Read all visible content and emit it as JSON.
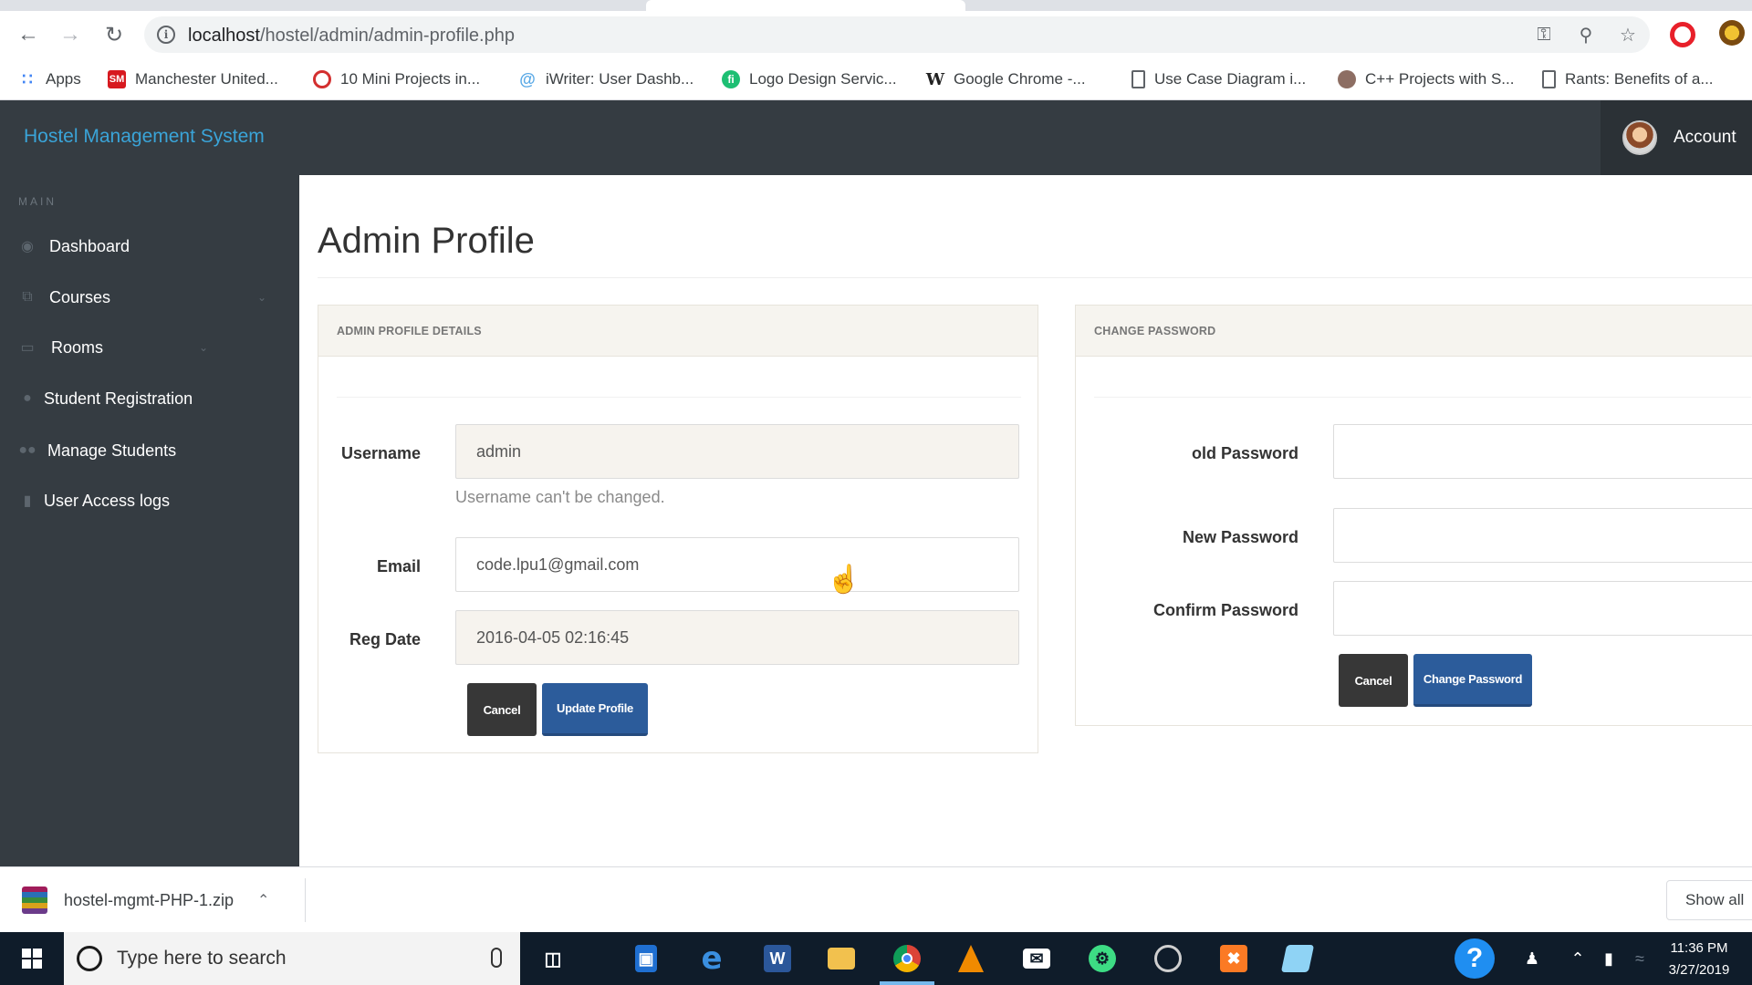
{
  "browser": {
    "url_host": "localhost",
    "url_path": "/hostel/admin/admin-profile.php",
    "bookmarks": [
      {
        "label": "Apps"
      },
      {
        "label": "Manchester United..."
      },
      {
        "label": "10 Mini Projects in..."
      },
      {
        "label": "iWriter: User Dashb..."
      },
      {
        "label": "Logo Design Servic..."
      },
      {
        "label": "Google Chrome -..."
      },
      {
        "label": "Use Case Diagram i..."
      },
      {
        "label": "C++ Projects with S..."
      },
      {
        "label": "Rants: Benefits of a..."
      }
    ]
  },
  "header": {
    "brand": "Hostel Management System",
    "account": "Account"
  },
  "sidebar": {
    "section": "MAIN",
    "items": [
      {
        "label": "Dashboard"
      },
      {
        "label": "Courses"
      },
      {
        "label": "Rooms"
      },
      {
        "label": "Student Registration"
      },
      {
        "label": "Manage Students"
      },
      {
        "label": "User Access logs"
      }
    ]
  },
  "main": {
    "title": "Admin Profile",
    "profile_panel": {
      "heading": "ADMIN PROFILE DETAILS",
      "username_label": "Username",
      "username_value": "admin",
      "username_help": "Username can't be changed.",
      "email_label": "Email",
      "email_value": "code.lpu1@gmail.com",
      "regdate_label": "Reg Date",
      "regdate_value": "2016-04-05 02:16:45",
      "cancel": "Cancel",
      "submit": "Update Profile"
    },
    "password_panel": {
      "heading": "CHANGE PASSWORD",
      "old_label": "old Password",
      "new_label": "New Password",
      "confirm_label": "Confirm Password",
      "cancel": "Cancel",
      "submit": "Change Password"
    }
  },
  "download_bar": {
    "file": "hostel-mgmt-PHP-1.zip",
    "show_all": "Show all"
  },
  "taskbar": {
    "search_placeholder": "Type here to search",
    "time": "11:36 PM",
    "date": "3/27/2019"
  },
  "colors": {
    "header_bg": "#353c42",
    "brand": "#3aa4d8",
    "primary_button": "#2c5c9b",
    "dark_button": "#373737"
  }
}
